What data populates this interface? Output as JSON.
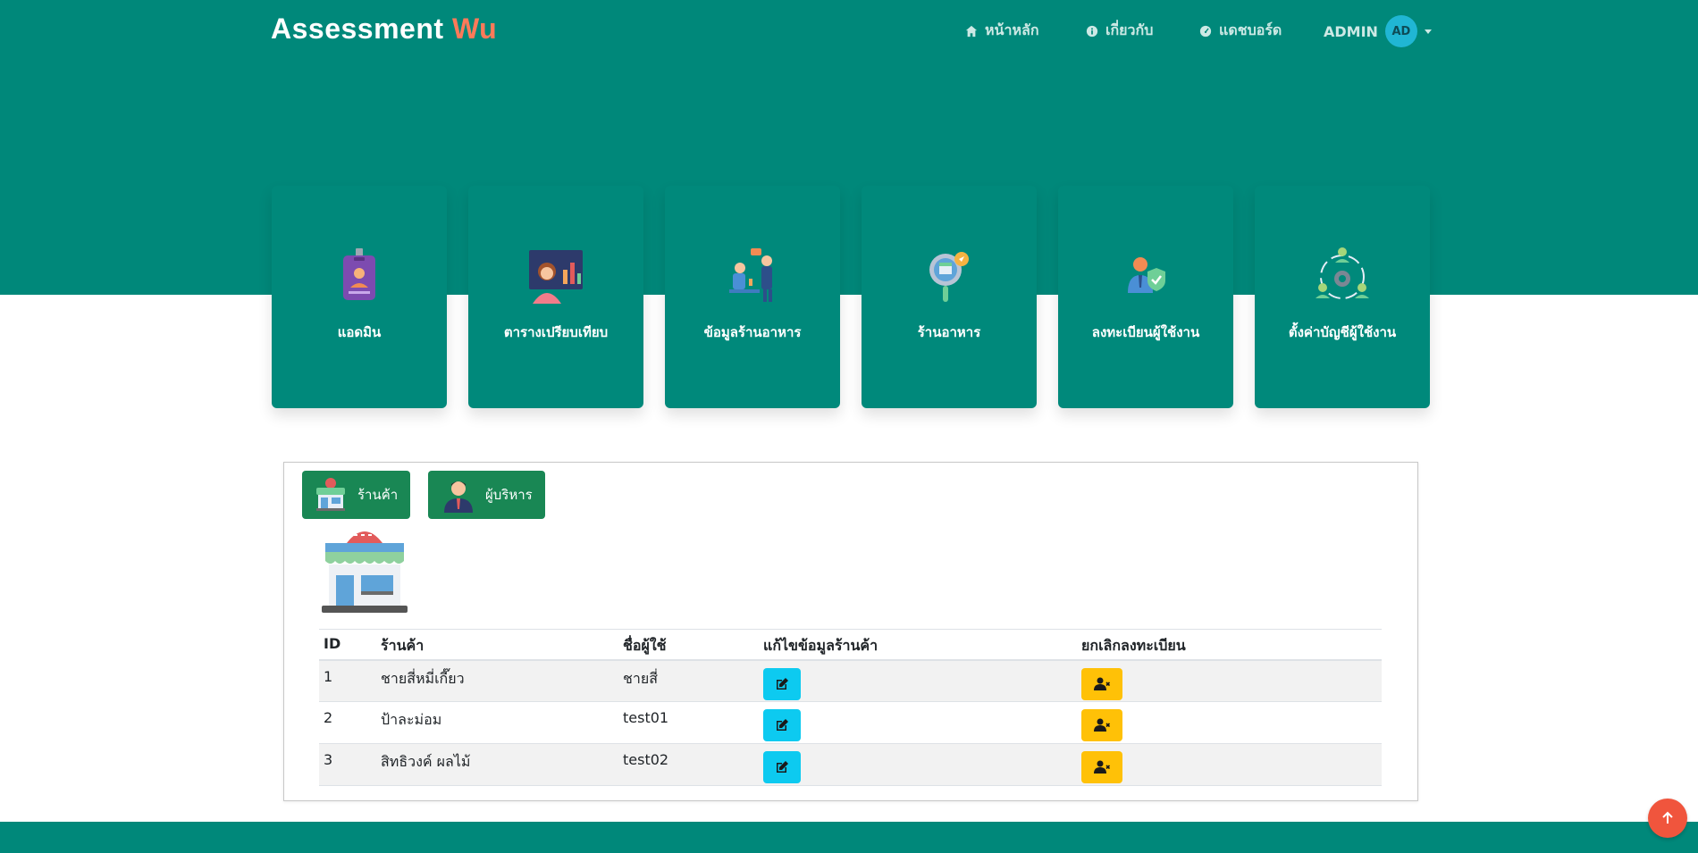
{
  "navbar": {
    "brand_main": "Assessment",
    "brand_accent": "Wu",
    "home_label": "หน้าหลัก",
    "about_label": "เกี่ยวกับ",
    "dashboard_label": "แดชบอร์ด",
    "user_label": "ADMIN",
    "avatar_initials": "AD"
  },
  "cards": [
    {
      "label": "แอดมิน",
      "icon": "id-badge-icon"
    },
    {
      "label": "ตารางเปรียบเทียบ",
      "icon": "presentation-chart-icon"
    },
    {
      "label": "ข้อมูลร้านอาหาร",
      "icon": "restaurant-service-icon"
    },
    {
      "label": "ร้านอาหาร",
      "icon": "restaurant-search-icon"
    },
    {
      "label": "ลงทะเบียนผู้ใช้งาน",
      "icon": "user-shield-icon"
    },
    {
      "label": "ตั้งค่าบัญชีผู้ใช้งาน",
      "icon": "users-settings-icon"
    }
  ],
  "tabs": {
    "shop_label": "ร้านค้า",
    "admin_label": "ผู้บริหาร"
  },
  "table": {
    "headers": [
      "ID",
      "ร้านค้า",
      "ชื่อผู้ใช้",
      "แก้ไขข้อมูลร้านค้า",
      "ยกเลิกลงทะเบียน"
    ],
    "rows": [
      {
        "id": "1",
        "shop": "ชายสี่หมี่เกี๊ยว",
        "username": "ชายสี่"
      },
      {
        "id": "2",
        "shop": "ป้าละม่อม",
        "username": "test01"
      },
      {
        "id": "3",
        "shop": "สิทธิวงค์ ผลไม้",
        "username": "test02"
      }
    ]
  },
  "colors": {
    "primary": "#00887a",
    "accent": "#ff7a59",
    "tab_green": "#198754",
    "edit_button": "#0dcaf0",
    "delete_button": "#ffc107",
    "scroll_top": "#f0553d"
  }
}
